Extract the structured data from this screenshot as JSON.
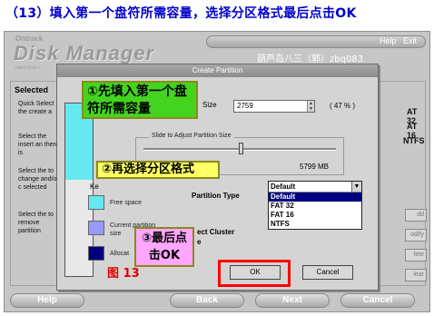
{
  "caption": "（13）填入第一个盘符所需容量，选择分区格式最后点击OK",
  "app": {
    "brand_small": "Ontrack",
    "brand_big": "Disk Manager",
    "brand_sub": "Hard Drive I",
    "help_label": "Help",
    "exit_label": "Exit",
    "watermark": "葫芦岛八三（郭）zbq083"
  },
  "panel": {
    "selected_label": "Selected",
    "options": [
      "Quick Select the create a",
      "Select the insert an there is",
      "Select the to change and/or c selected",
      "Select the to remove partition"
    ],
    "fat32": "AT 32",
    "fat16": "AT 16",
    "ntfs": "NTFS",
    "side_buttons": [
      "dd",
      "odify",
      "lete",
      "lear"
    ]
  },
  "dialog": {
    "title": "Create Partition",
    "size_label": "Size",
    "size_value": "2759",
    "percent": "( 47 % )",
    "slider_legend": "Slide to Adjust Partition Size",
    "mb_value": "5799 MB",
    "key_label": "Ke",
    "legend_free": "Free space",
    "legend_current": "Current partition size",
    "legend_alloc": "Allocat",
    "partition_type_label": "Partition Type",
    "cluster_label": "ect Cluster",
    "cluster_label2": "e",
    "dropdown": {
      "selected": "Default",
      "options": [
        "Default",
        "FAT 32",
        "FAT 16",
        "NTFS"
      ]
    },
    "ok_label": "OK",
    "cancel_label": "Cancel",
    "colors": {
      "free": "#66e8f0",
      "current": "#9999ff",
      "allocated": "#00007f"
    }
  },
  "callouts": {
    "step1": "①先填入第一个盘符所需容量",
    "step2": "②再选择分区格式",
    "step3": "③最后点击OK"
  },
  "bottom": {
    "help": "Help",
    "back": "Back",
    "next": "Next",
    "cancel": "Cancel",
    "figure_label": "图 13"
  }
}
